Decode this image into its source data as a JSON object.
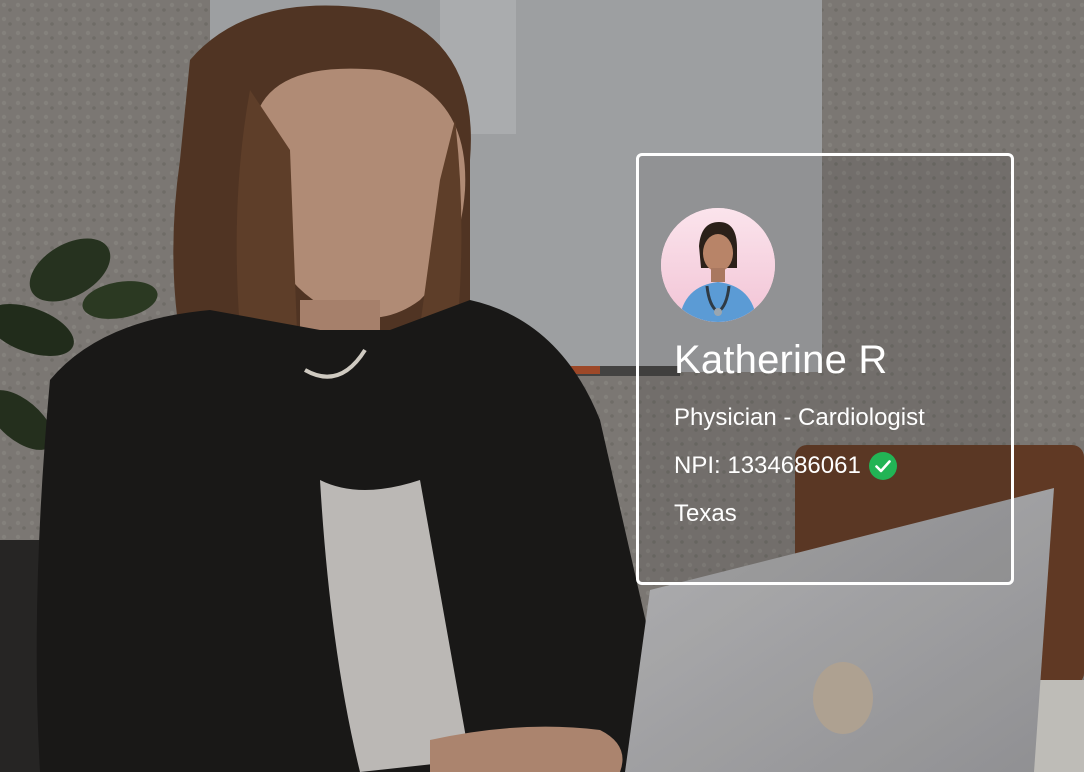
{
  "scene": {
    "description_icon": "woman-working-on-laptop-photo",
    "colors": {
      "wall": "#8b8782",
      "jacket": "#1c1b1a",
      "laptop": "#bdbdbf",
      "hair": "#6e4a33",
      "skin": "#c89c84",
      "chair": "#7a4a2e"
    }
  },
  "profile": {
    "avatar_icon": "doctor-avatar-icon",
    "name": "Katherine R",
    "role": "Physician - Cardiologist",
    "npi": "NPI: 1334686061",
    "verified_icon": "check-circle-icon",
    "verified_color": "#22b455",
    "state": "Texas"
  }
}
